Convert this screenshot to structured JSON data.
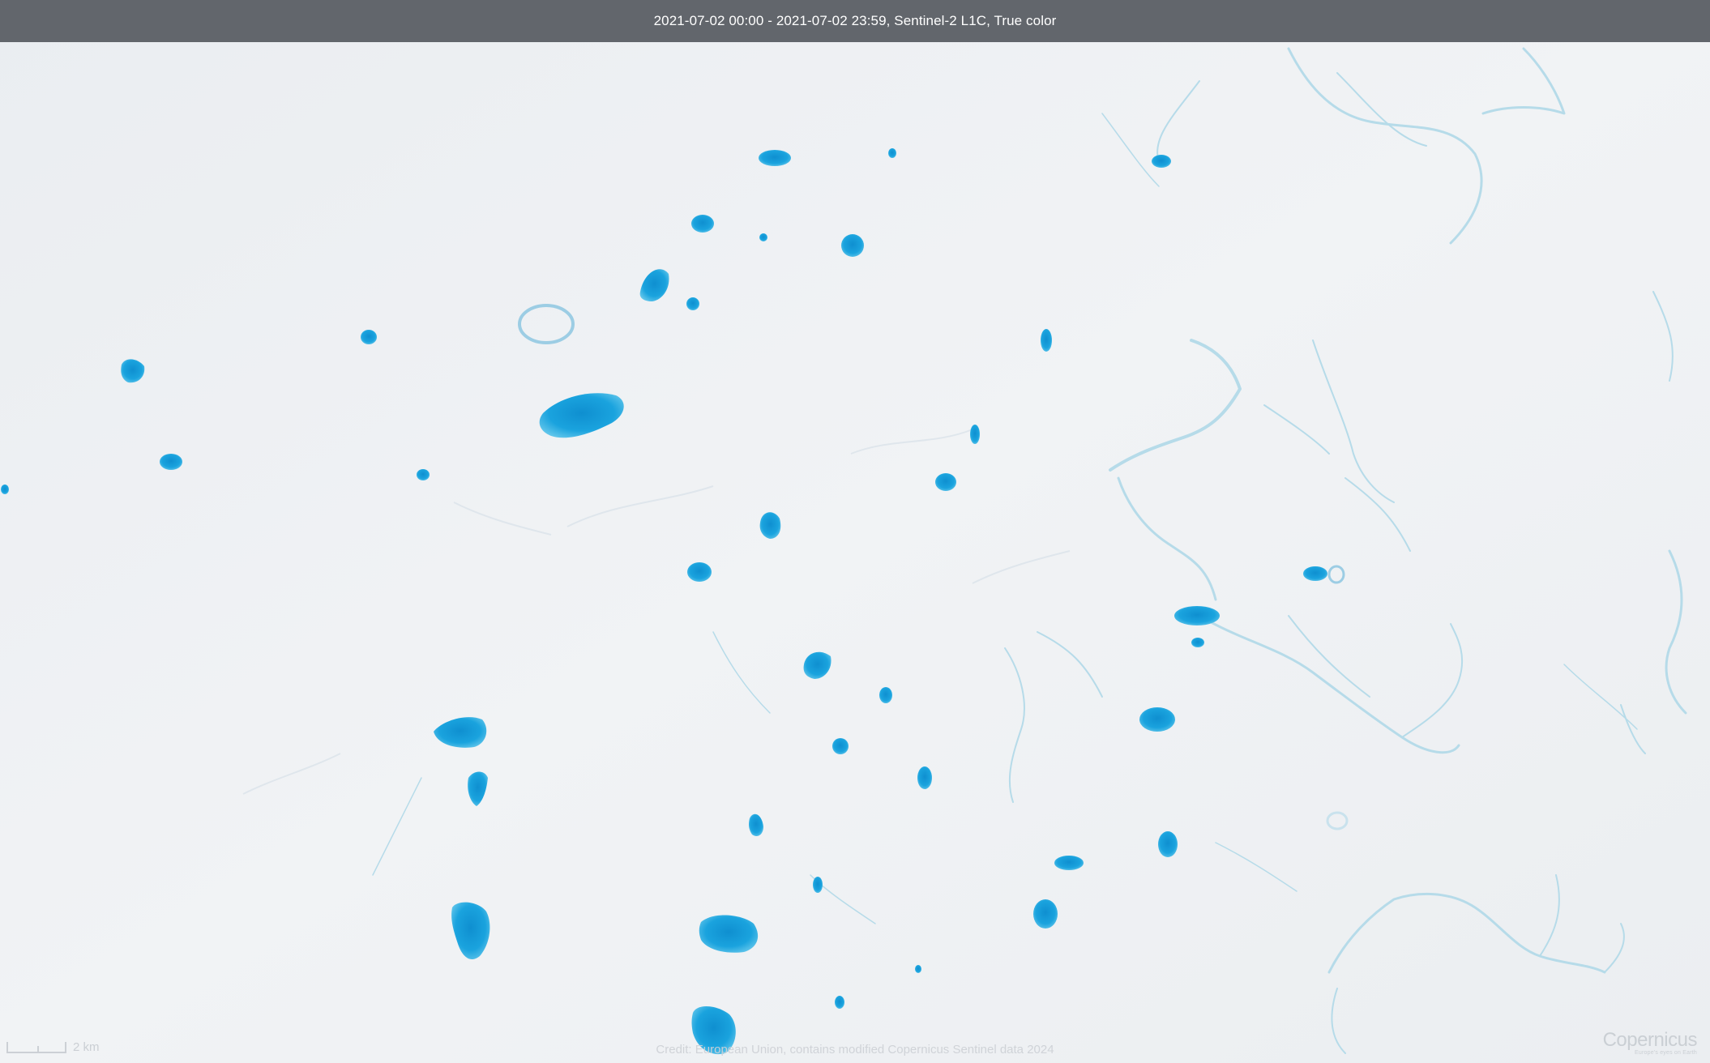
{
  "header": {
    "title": "2021-07-02 00:00 - 2021-07-02 23:59, Sentinel-2 L1C, True color"
  },
  "map": {
    "surface_color": "#eef0f3",
    "water_color": "#1aa0dc",
    "channel_color": "#b6dbe9"
  },
  "scale": {
    "label": "2 km"
  },
  "footer": {
    "credit": "Credit: European Union, contains modified Copernicus Sentinel data 2024"
  },
  "logo": {
    "text": "Copernicus",
    "tagline": "Europe's eyes on Earth"
  }
}
